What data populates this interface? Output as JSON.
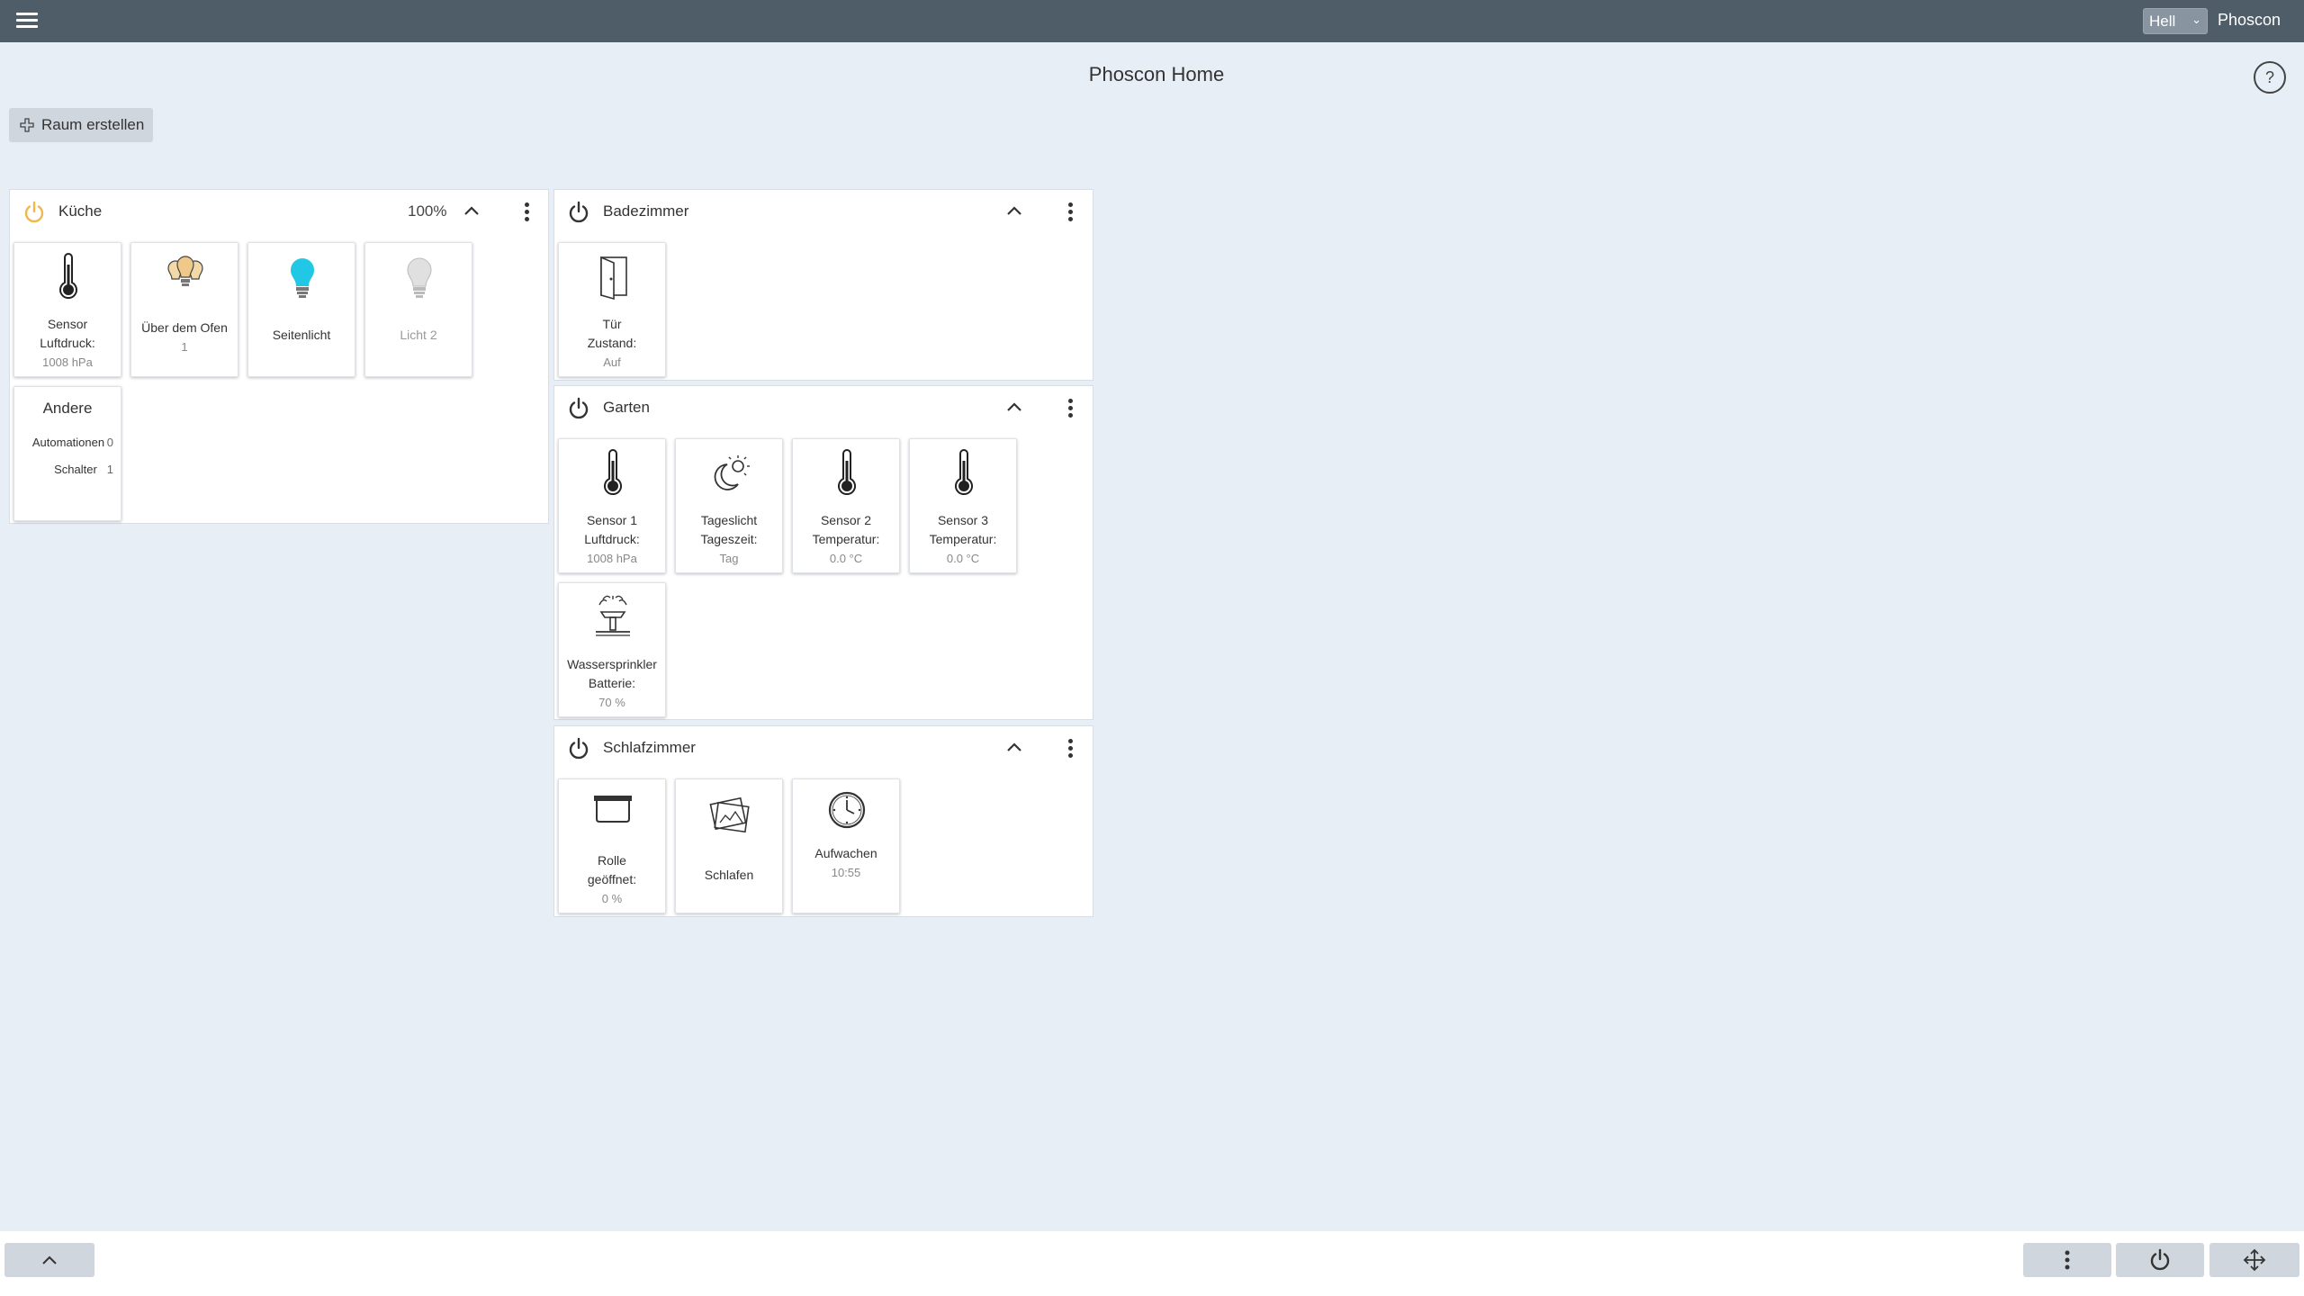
{
  "header": {
    "theme_selected": "Hell",
    "brand": "Phoscon"
  },
  "page": {
    "title": "Phoscon Home",
    "help": "?",
    "create_room": "Raum erstellen"
  },
  "rooms": {
    "kueche": {
      "name": "Küche",
      "brightness": "100%",
      "tiles": [
        {
          "line1": "Sensor",
          "line2": "Luftdruck:",
          "value": "1008 hPa"
        },
        {
          "line1": "Über dem Ofen",
          "value": "1"
        },
        {
          "line1": "Seitenlicht"
        },
        {
          "line1": "Licht 2"
        }
      ],
      "andere": {
        "title": "Andere",
        "rows": [
          {
            "label": "Automationen",
            "count": "0"
          },
          {
            "label": "Schalter",
            "count": "1"
          }
        ]
      }
    },
    "badezimmer": {
      "name": "Badezimmer",
      "tiles": [
        {
          "line1": "Tür",
          "line2": "Zustand:",
          "value": "Auf"
        }
      ]
    },
    "garten": {
      "name": "Garten",
      "tiles": [
        {
          "line1": "Sensor 1",
          "line2": "Luftdruck:",
          "value": "1008 hPa"
        },
        {
          "line1": "Tageslicht",
          "line2": "Tageszeit:",
          "value": "Tag"
        },
        {
          "line1": "Sensor 2",
          "line2": "Temperatur:",
          "value": "0.0 °C"
        },
        {
          "line1": "Sensor 3",
          "line2": "Temperatur:",
          "value": "0.0 °C"
        },
        {
          "line1": "Wassersprinkler",
          "line2": "Batterie:",
          "value": "70 %"
        }
      ]
    },
    "schlafzimmer": {
      "name": "Schlafzimmer",
      "tiles": [
        {
          "line1": "Rolle",
          "line2": "geöffnet:",
          "value": "0 %"
        },
        {
          "line1": "Schlafen"
        },
        {
          "line1": "Aufwachen",
          "value": "10:55"
        }
      ]
    }
  },
  "colors": {
    "topbar": "#4f5d69",
    "background": "#e8eef5",
    "power_active": "#f0b84a",
    "light_on": "#21c8e6",
    "light_dim": "#cccccc"
  },
  "icons": {
    "menu": "hamburger-icon",
    "help": "help-icon",
    "power": "power-icon",
    "collapse": "chevron-up-icon",
    "more": "more-vertical-icon",
    "move": "move-icon"
  }
}
